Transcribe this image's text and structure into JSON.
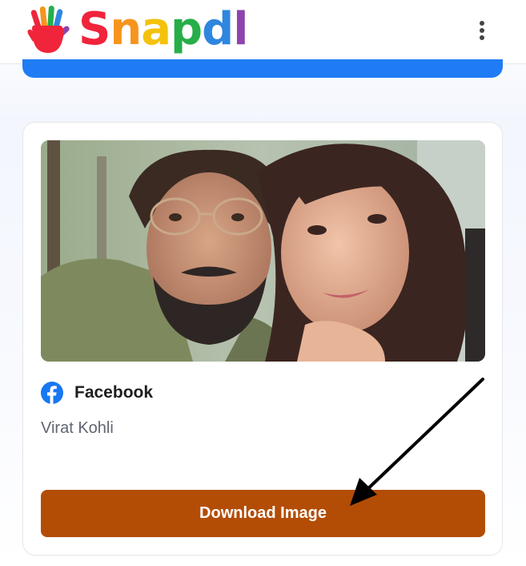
{
  "brand": {
    "name_letters": [
      "S",
      "n",
      "a",
      "p",
      "d",
      "l"
    ],
    "letter_colors": [
      "#f0243a",
      "#f7941d",
      "#f4c20d",
      "#27ae48",
      "#2e86de",
      "#8e44ad"
    ],
    "logo_icon": "rainbow-hand-icon"
  },
  "header": {
    "menu_icon": "vertical-dots-icon"
  },
  "accent_colors": {
    "top_bar": "#1f7cf4",
    "download_button": "#b34d06",
    "facebook": "#1877f2"
  },
  "result": {
    "image_icon": "photo",
    "platform": "Facebook",
    "platform_icon": "facebook-icon",
    "author": "Virat Kohli",
    "download_label": "Download Image"
  },
  "annotation": {
    "arrow_icon": "black-arrow-pointing-to-download-button"
  }
}
